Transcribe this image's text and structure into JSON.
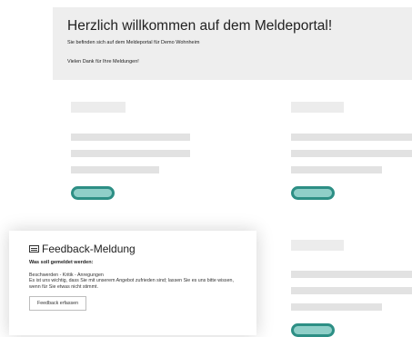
{
  "welcome": {
    "title": "Herzlich willkommen auf dem Meldeportal!",
    "subtitle": "Sie befinden sich auf dem Meldeportal für Demo Wohnheim",
    "thanks": "Vielen Dank für Ihre Meldungen!"
  },
  "feedback": {
    "icon": "list-icon",
    "title": "Feedback-Meldung",
    "question": "Was soll gemeldet werden:",
    "topics": "Beschwerden - Kritik - Anregungen",
    "description": "Es ist uns wichtig, dass Sie mit unserem Angebot zufrieden sind; lassen Sie es uns bitte wissen, wenn für Sie etwas nicht stimmt.",
    "button": "Feedback erfassen"
  },
  "colors": {
    "accent": "#2d8f85",
    "accent_fill": "#8fcfc8",
    "placeholder": "#e2e2e2",
    "banner_bg": "#eeeeee"
  }
}
